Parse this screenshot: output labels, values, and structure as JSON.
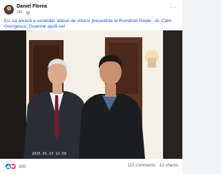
{
  "post": {
    "author": "Daniel Florea",
    "time": "22h",
    "text": "Eu, ca pleavă a societății, alături de viitorul președinte al României Reale - dl. Călin Georgescu. Doamne ajută-ne!"
  },
  "photo": {
    "timestamp": "2025.01.13 21:59"
  },
  "stats": {
    "reactions_count": "385",
    "comments": "115 comments",
    "shares": "12 shares"
  },
  "icons": {
    "privacy": "globe-icon",
    "menu": "more-icon",
    "reaction_like": "like-icon",
    "reaction_love": "love-icon"
  },
  "colors": {
    "text_link": "#1a57d6",
    "like": "#1877f2",
    "love": "#f33e58",
    "muted": "#65676b"
  }
}
